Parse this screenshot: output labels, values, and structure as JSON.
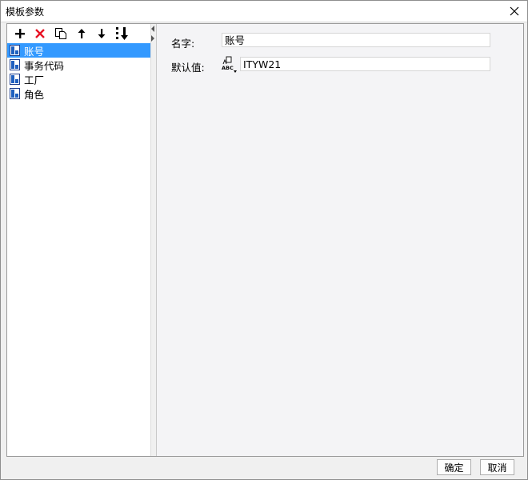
{
  "dialog": {
    "title": "模板参数",
    "close_icon": "close-icon"
  },
  "toolbar": {
    "buttons": [
      {
        "icon": "add-icon"
      },
      {
        "icon": "delete-icon"
      },
      {
        "icon": "copy-icon"
      },
      {
        "icon": "move-up-icon"
      },
      {
        "icon": "move-down-icon"
      },
      {
        "icon": "sort-icon"
      }
    ]
  },
  "tree": {
    "items": [
      {
        "label": "账号",
        "selected": true
      },
      {
        "label": "事务代码",
        "selected": false
      },
      {
        "label": "工厂",
        "selected": false
      },
      {
        "label": "角色",
        "selected": false
      }
    ]
  },
  "form": {
    "name_label": "名字:",
    "name_value": "账号",
    "default_label": "默认值:",
    "default_value": "ITYW21",
    "type_icon": "abc-type-icon"
  },
  "footer": {
    "ok_label": "确定",
    "cancel_label": "取消"
  },
  "colors": {
    "selection": "#3399ff",
    "delete": "#e81123"
  }
}
